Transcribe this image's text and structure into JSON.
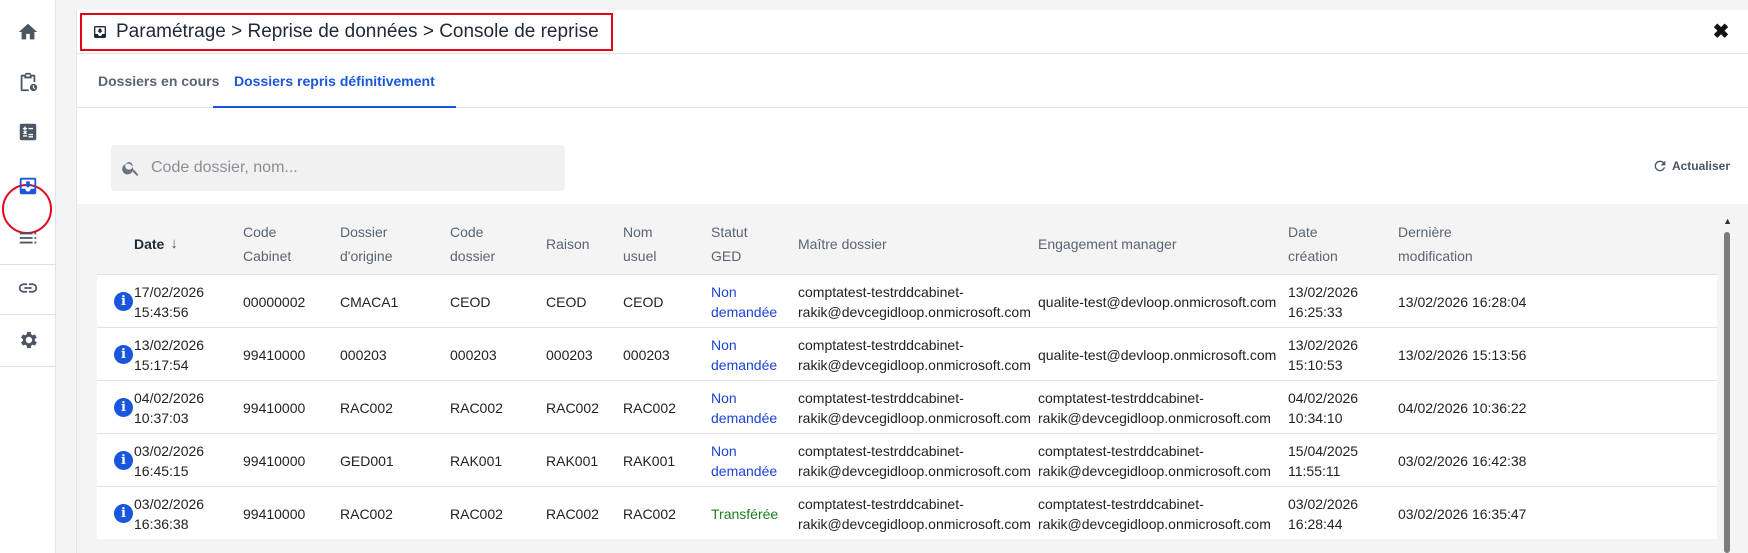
{
  "sidebar": {
    "items": [
      {
        "name": "home-icon"
      },
      {
        "name": "clipboard-clock-icon"
      },
      {
        "name": "calculator-icon"
      },
      {
        "name": "inbox-tray-icon"
      },
      {
        "name": "list-icon"
      },
      {
        "name": "link-icon"
      },
      {
        "name": "gear-icon"
      }
    ],
    "active": "inbox-tray-icon"
  },
  "header": {
    "breadcrumb": "Paramétrage > Reprise de données > Console de reprise",
    "close_icon": "✖"
  },
  "tabs": [
    {
      "label": "Dossiers en cours",
      "active": false
    },
    {
      "label": "Dossiers repris définitivement",
      "active": true
    }
  ],
  "search": {
    "placeholder": "Code dossier, nom...",
    "value": ""
  },
  "refresh_label": "Actualiser",
  "table": {
    "columns": [
      "Date",
      "Code\nCabinet",
      "Dossier\nd'origine",
      "Code\ndossier",
      "Raison",
      "Nom\nusuel",
      "Statut\nGED",
      "Maître dossier",
      "Engagement manager",
      "Date\ncréation",
      "Dernière\nmodification"
    ],
    "sort_arrow": "↓",
    "rows": [
      {
        "date": "17/02/2026\n15:43:56",
        "code_cabinet": "00000002",
        "dossier_origine": "CMACA1",
        "code_dossier": "CEOD",
        "raison": "CEOD",
        "nom_usuel": "CEOD",
        "statut": "Non\ndemandée",
        "maitre": "comptatest-testrddcabinet-\nrakik@devcegidloop.onmicrosoft.com",
        "engagement": "qualite-test@devloop.onmicrosoft.com",
        "date_creation": "13/02/2026\n16:25:33",
        "derniere_modif": "13/02/2026 16:28:04"
      },
      {
        "date": "13/02/2026\n15:17:54",
        "code_cabinet": "99410000",
        "dossier_origine": "000203",
        "code_dossier": "000203",
        "raison": "000203",
        "nom_usuel": "000203",
        "statut": "Non\ndemandée",
        "maitre": "comptatest-testrddcabinet-\nrakik@devcegidloop.onmicrosoft.com",
        "engagement": "qualite-test@devloop.onmicrosoft.com",
        "date_creation": "13/02/2026\n15:10:53",
        "derniere_modif": "13/02/2026 15:13:56"
      },
      {
        "date": "04/02/2026\n10:37:03",
        "code_cabinet": "99410000",
        "dossier_origine": "RAC002",
        "code_dossier": "RAC002",
        "raison": "RAC002",
        "nom_usuel": "RAC002",
        "statut": "Non\ndemandée",
        "maitre": "comptatest-testrddcabinet-\nrakik@devcegidloop.onmicrosoft.com",
        "engagement": "comptatest-testrddcabinet-\nrakik@devcegidloop.onmicrosoft.com",
        "date_creation": "04/02/2026\n10:34:10",
        "derniere_modif": "04/02/2026 10:36:22"
      },
      {
        "date": "03/02/2026\n16:45:15",
        "code_cabinet": "99410000",
        "dossier_origine": "GED001",
        "code_dossier": "RAK001",
        "raison": "RAK001",
        "nom_usuel": "RAK001",
        "statut": "Non\ndemandée",
        "maitre": "comptatest-testrddcabinet-\nrakik@devcegidloop.onmicrosoft.com",
        "engagement": "comptatest-testrddcabinet-\nrakik@devcegidloop.onmicrosoft.com",
        "date_creation": "15/04/2025\n11:55:11",
        "derniere_modif": "03/02/2026 16:42:38"
      },
      {
        "date": "03/02/2026\n16:36:38",
        "code_cabinet": "99410000",
        "dossier_origine": "RAC002",
        "code_dossier": "RAC002",
        "raison": "RAC002",
        "nom_usuel": "RAC002",
        "statut": "Transférée",
        "maitre": "comptatest-testrddcabinet-\nrakik@devcegidloop.onmicrosoft.com",
        "engagement": "comptatest-testrddcabinet-\nrakik@devcegidloop.onmicrosoft.com",
        "date_creation": "03/02/2026\n16:28:44",
        "derniere_modif": "03/02/2026 16:35:47"
      }
    ]
  },
  "colors": {
    "accent": "#1a56db",
    "status_non": "#1a44d6",
    "status_transferee": "#1e7d1e",
    "highlight_red": "#e1061a"
  }
}
